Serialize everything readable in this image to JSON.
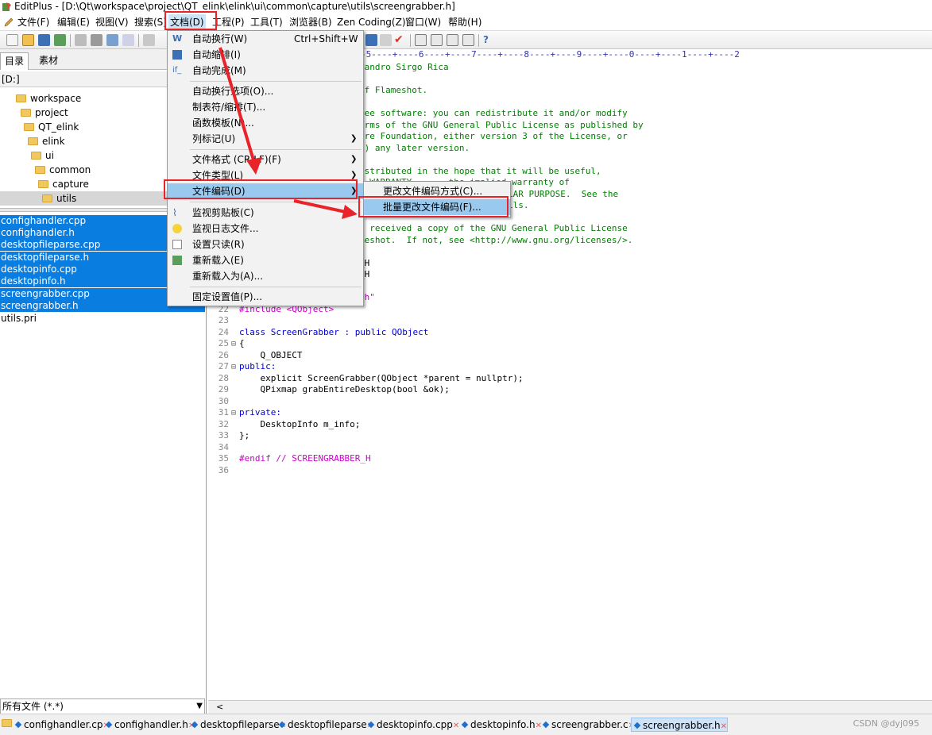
{
  "window": {
    "title": "EditPlus - [D:\\Qt\\workspace\\project\\QT_elink\\elink\\ui\\common\\capture\\utils\\screengrabber.h]"
  },
  "menubar": {
    "file": "文件(F)",
    "edit": "编辑(E)",
    "view": "视图(V)",
    "search": "搜索(S)",
    "document": "文档(D)",
    "project": "工程(P)",
    "tools": "工具(T)",
    "browser": "浏览器(B)",
    "zen": "Zen Coding(Z)",
    "window": "窗口(W)",
    "help": "帮助(H)"
  },
  "sidebar": {
    "tab_dir": "目录",
    "tab_material": "素材",
    "drive": "[D:]",
    "tree": [
      "workspace",
      "project",
      "QT_elink",
      "elink",
      "ui",
      "common",
      "capture",
      "utils"
    ],
    "files": [
      "confighandler.cpp",
      "confighandler.h",
      "desktopfileparse.cpp",
      "desktopfileparse.h",
      "desktopinfo.cpp",
      "desktopinfo.h",
      "screengrabber.cpp",
      "screengrabber.h",
      "utils.pri"
    ],
    "filter": "所有文件 (*.*)"
  },
  "editor": {
    "ruler": "+----+----3----+----4----+----5----+----6----+----7----+----8----+----9----+----0----+----1----+----2",
    "lines_visible": [
      {
        "text": "jandro Sirgo Rica"
      },
      {
        "text": ""
      },
      {
        "text": "of Flameshot."
      },
      {
        "text": ""
      },
      {
        "text": "ree software: you can redistribute it and/or modify"
      },
      {
        "text": "erms of the GNU General Public License as published by"
      },
      {
        "text": "are Foundation, either version 3 of the License, or"
      },
      {
        "text": "n) any later version."
      },
      {
        "text": ""
      },
      {
        "text": "istributed in the hope that it will be useful,"
      },
      {
        "text": "  WARRANTY       the implied warranty of"
      },
      {
        "text": "LAR PURPOSE.  See the"
      },
      {
        "text": "ils."
      },
      {
        "text": ""
      },
      {
        "text": "e received a copy of the GNU General Public License"
      },
      {
        "text": "meshot.  If not, see <http://www.gnu.org/licenses/>."
      },
      {
        "text": ""
      },
      {
        "text": "_H"
      },
      {
        "text": "_H"
      },
      {
        "text": ""
      },
      {
        "text": ".h\""
      }
    ],
    "code": [
      {
        "n": "22",
        "fold": "",
        "text": "#include <QObject>"
      },
      {
        "n": "23",
        "fold": "",
        "text": ""
      },
      {
        "n": "24",
        "fold": "",
        "text": "class ScreenGrabber : public QObject"
      },
      {
        "n": "25",
        "fold": "⊟",
        "text": "{"
      },
      {
        "n": "26",
        "fold": "",
        "text": "    Q_OBJECT"
      },
      {
        "n": "27",
        "fold": "⊟",
        "text": "public:"
      },
      {
        "n": "28",
        "fold": "",
        "text": "    explicit ScreenGrabber(QObject *parent = nullptr);"
      },
      {
        "n": "29",
        "fold": "",
        "text": "    QPixmap grabEntireDesktop(bool &ok);"
      },
      {
        "n": "30",
        "fold": "",
        "text": ""
      },
      {
        "n": "31",
        "fold": "⊟",
        "text": "private:"
      },
      {
        "n": "32",
        "fold": "",
        "text": "    DesktopInfo m_info;"
      },
      {
        "n": "33",
        "fold": "",
        "text": "};"
      },
      {
        "n": "34",
        "fold": "",
        "text": ""
      },
      {
        "n": "35",
        "fold": "",
        "text": "#endif // SCREENGRABBER_H"
      },
      {
        "n": "36",
        "fold": "",
        "text": ""
      }
    ]
  },
  "document_menu": {
    "word_wrap": "自动换行(W)",
    "word_wrap_shortcut": "Ctrl+Shift+W",
    "auto_indent": "自动缩排(I)",
    "auto_complete": "自动完成(M)",
    "wrap_options": "自动换行选项(O)...",
    "tab_indent": "制表符/缩排(T)...",
    "function_template": "函数模板(N)...",
    "column_marker": "列标记(U)",
    "file_format": "文件格式 (CR/LF)(F)",
    "file_type": "文件类型(L)",
    "file_encoding": "文件编码(D)",
    "monitor_clipboard": "监视剪贴板(C)",
    "monitor_log": "监视日志文件...",
    "read_only": "设置只读(R)",
    "reload": "重新载入(E)",
    "reload_as": "重新载入为(A)...",
    "fixed_settings": "固定设置值(P)..."
  },
  "encoding_submenu": {
    "change_encoding": "更改文件编码方式(C)...",
    "batch_change": "批量更改文件编码(F)..."
  },
  "doc_tabs": [
    "confighandler.cp",
    "confighandler.h",
    "desktopfileparse",
    "desktopfileparse",
    "desktopinfo.cpp",
    "desktopinfo.h",
    "screengrabber.c",
    "screengrabber.h"
  ],
  "watermark": "CSDN @dyj095",
  "colors": {
    "selection": "#0a7de0",
    "menu_highlight": "#99c9ef",
    "annotation": "#e8242a",
    "comment": "#008000",
    "keyword": "#0000cc"
  }
}
